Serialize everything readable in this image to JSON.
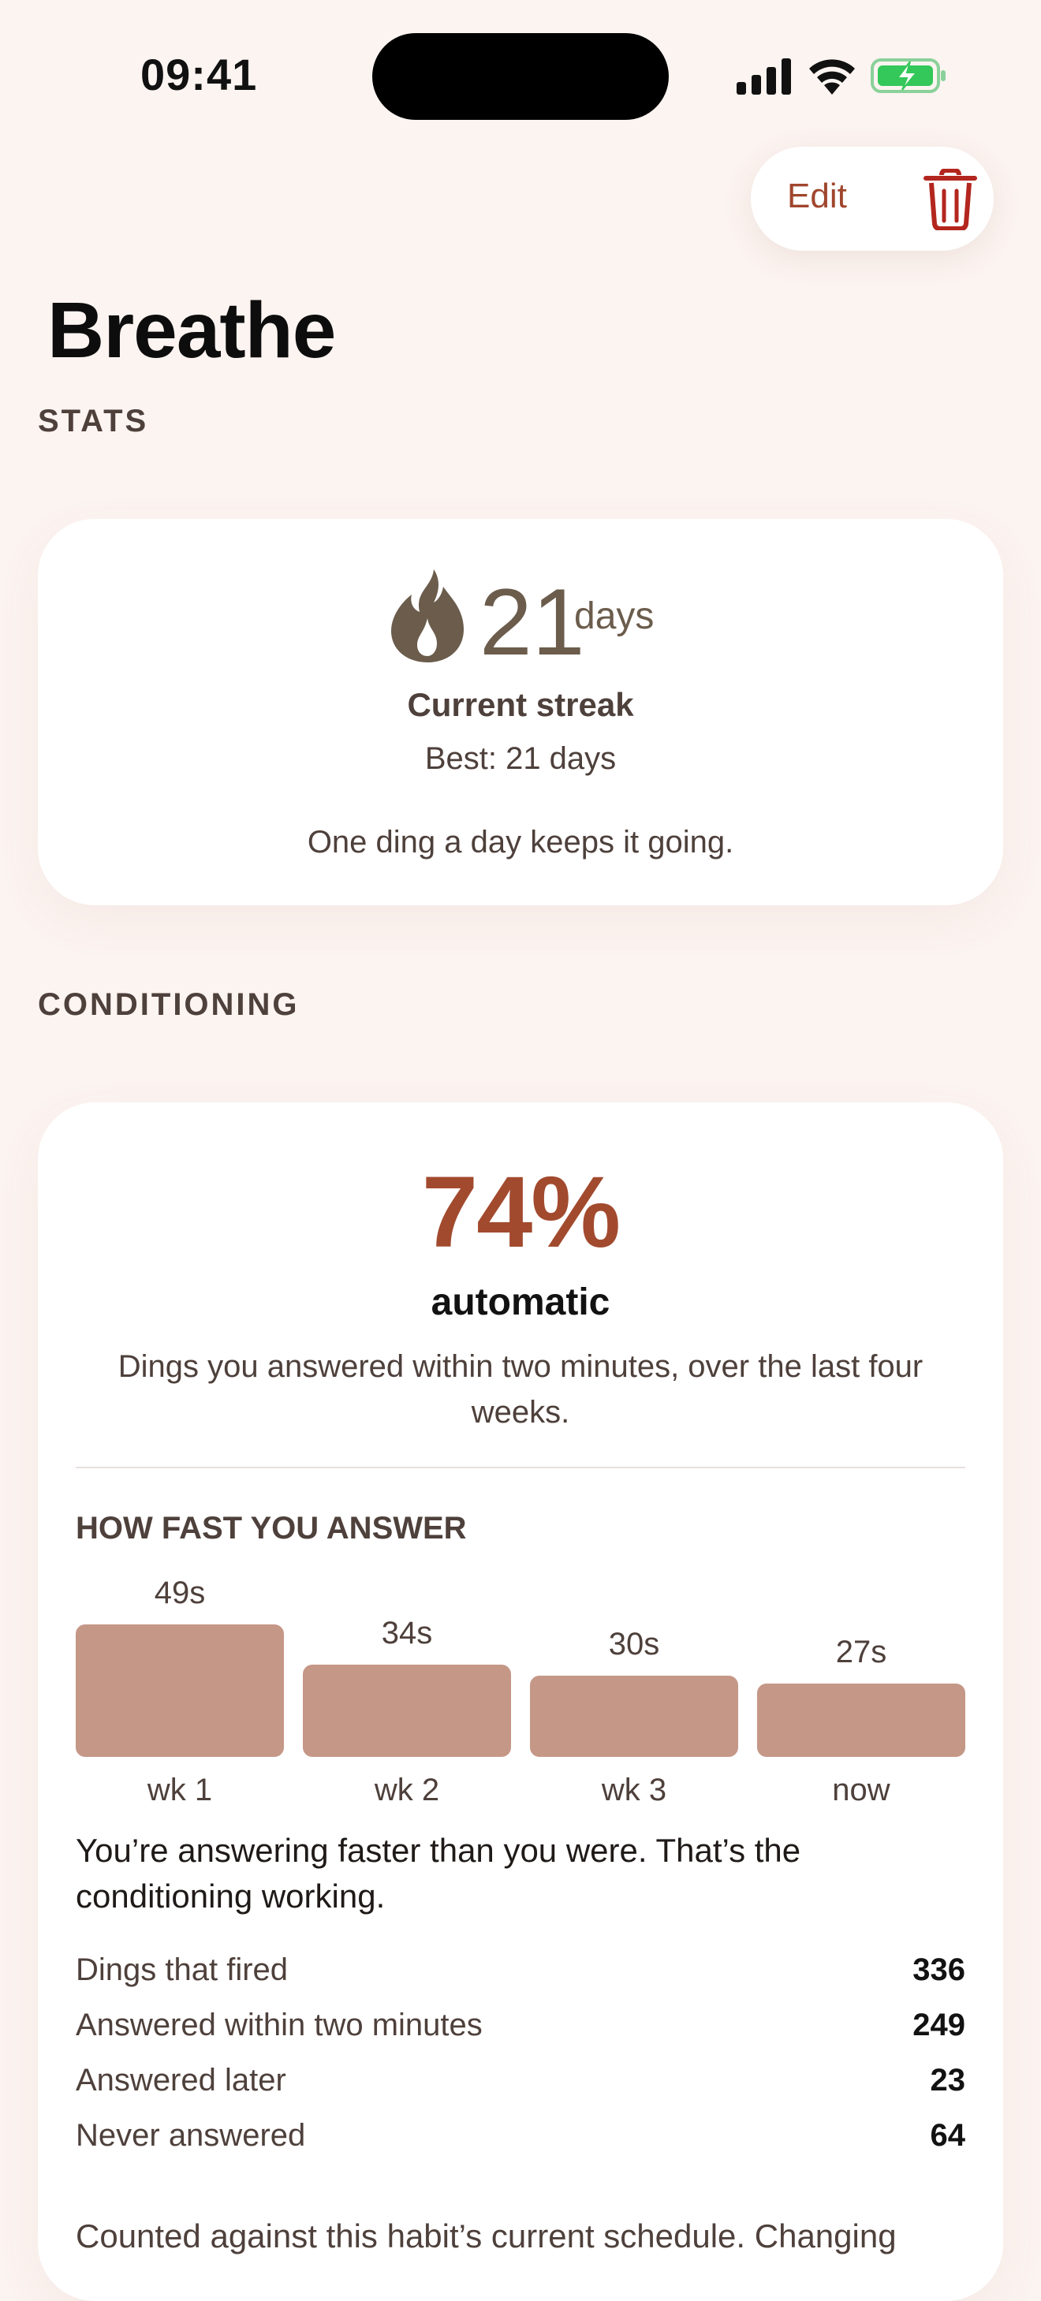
{
  "status_bar": {
    "time": "09:41"
  },
  "header": {
    "edit_label": "Edit",
    "title": "Breathe"
  },
  "sections": {
    "stats": "STATS",
    "conditioning": "CONDITIONING"
  },
  "streak": {
    "value": "21",
    "unit": "days",
    "caption": "Current streak",
    "best": "Best: 21 days",
    "note": "One ding a day keeps it going."
  },
  "conditioning": {
    "percent": "74%",
    "label": "automatic",
    "description": "Dings you answered within two minutes, over the last four weeks.",
    "speed_label": "HOW FAST YOU ANSWER",
    "insight": "You’re answering faster than you were. That’s the conditioning working.",
    "stats": [
      {
        "label": "Dings that fired",
        "value": "336"
      },
      {
        "label": "Answered within two minutes",
        "value": "249"
      },
      {
        "label": "Answered later",
        "value": "23"
      },
      {
        "label": "Never answered",
        "value": "64"
      }
    ],
    "footnote": "Counted against this habit’s current schedule. Changing"
  },
  "chart_data": {
    "type": "bar",
    "title": "HOW FAST YOU ANSWER",
    "categories": [
      "wk 1",
      "wk 2",
      "wk 3",
      "now"
    ],
    "values": [
      49,
      34,
      30,
      27
    ],
    "value_labels": [
      "49s",
      "34s",
      "30s",
      "27s"
    ],
    "ylim": [
      0,
      49
    ],
    "grid": false,
    "color": "#c59787"
  },
  "colors": {
    "background": "#fcf4f1",
    "accent": "#a24a2e",
    "flame": "#6b5c4c",
    "trash": "#b3261e",
    "battery": "#34c759"
  },
  "icons": {
    "trash": "trash-icon",
    "flame": "flame-icon",
    "signal": "cellular-signal-icon",
    "wifi": "wifi-icon",
    "battery": "battery-charging-icon"
  }
}
